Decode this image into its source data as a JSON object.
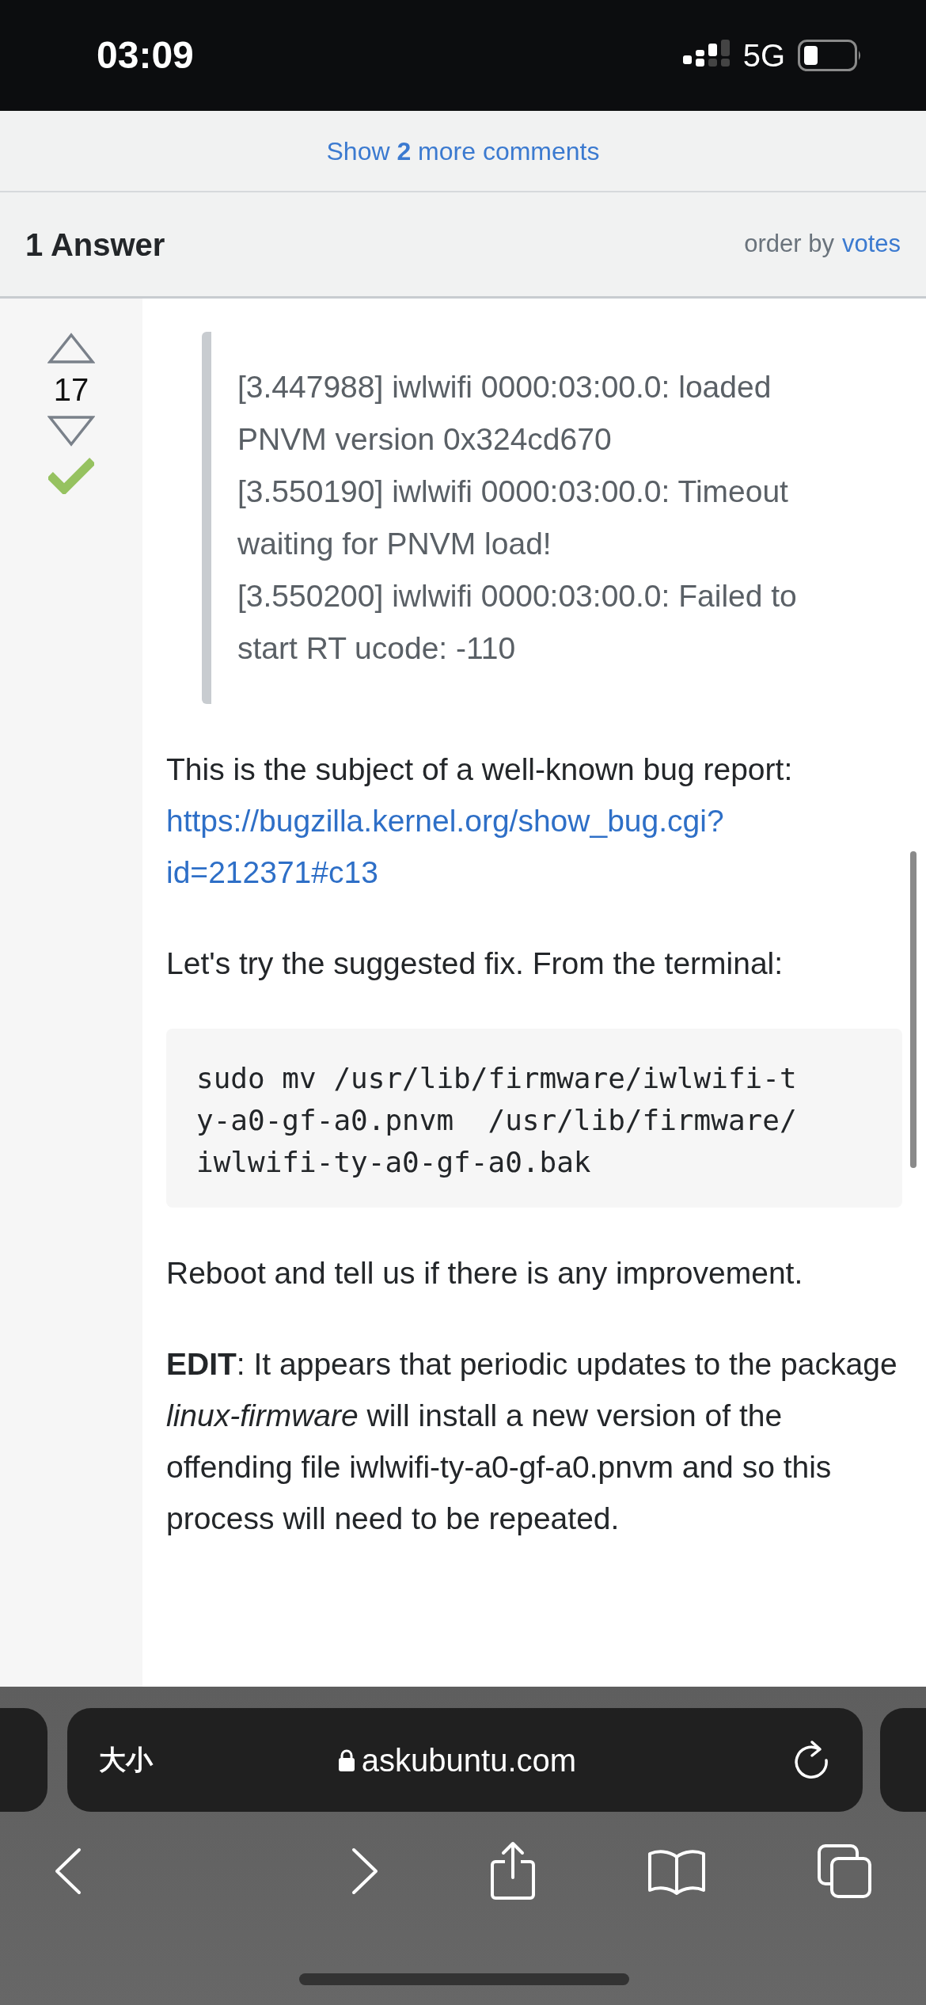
{
  "status_bar": {
    "time": "03:09",
    "network": "5G"
  },
  "comments_link": "Show **2** more comments",
  "answers_header": {
    "title": "1 Answer",
    "order_label": "order by",
    "order_value": "votes"
  },
  "answer": {
    "votes": "17",
    "accepted": true,
    "quote_lines": [
      "[3.447988] iwlwifi 0000:03:00.0: loaded PNVM version 0x324cd670",
      "[3.550190] iwlwifi 0000:03:00.0: Timeout waiting for PNVM load!",
      "[3.550200] iwlwifi 0000:03:00.0: Failed to start RT ucode: -110"
    ],
    "blocks": [
      {
        "kind": "text",
        "text": "This is the subject of a well-known bug report:"
      },
      {
        "kind": "link",
        "text": "https://bugzilla.kernel.org/show_bug.cgi?id=212371#c13"
      },
      {
        "kind": "text",
        "text": "Let's try the suggested fix. From the terminal:"
      },
      {
        "kind": "code",
        "text": "sudo mv /usr/lib/firmware/iwlwifi-ty-a0-gf-a0.pnvm  /usr/lib/firmware/iwlwifi-ty-a0-gf-a0.bak"
      },
      {
        "kind": "text",
        "text": "Reboot and tell us if there is any improvement."
      },
      {
        "kind": "text",
        "text": "**EDIT**: It appears that periodic updates to the package *linux-firmware* will install a new version of the offending file iwlwifi-ty-a0-gf-a0.pnvm and so this process will need to be repeated."
      }
    ]
  },
  "browser": {
    "reader_button": "大小",
    "url": "askubuntu.com",
    "secure": true
  }
}
